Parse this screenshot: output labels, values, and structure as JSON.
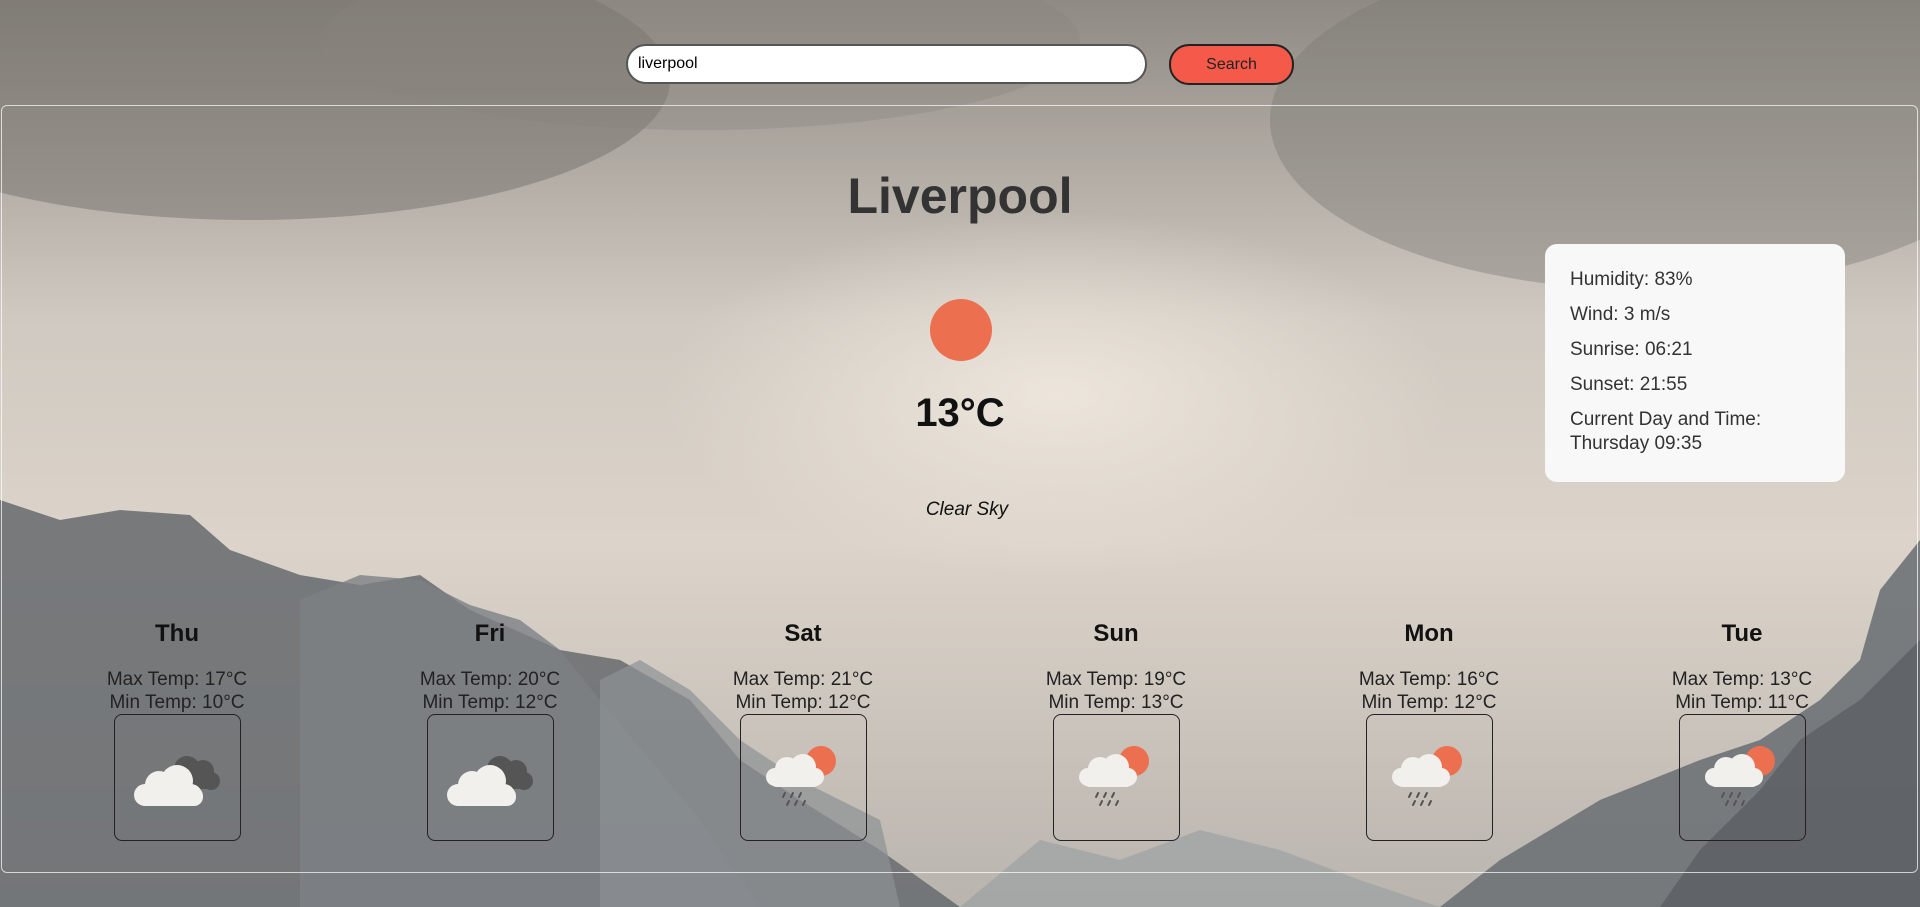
{
  "search": {
    "value": "liverpool",
    "button_label": "Search"
  },
  "current": {
    "city": "Liverpool",
    "temperature": "13°C",
    "description": "Clear Sky",
    "icon": "sun-icon",
    "details": {
      "humidity": "Humidity: 83%",
      "wind": "Wind: 3 m/s",
      "sunrise": "Sunrise: 06:21",
      "sunset": "Sunset: 21:55",
      "datetime_label": "Current Day and Time:",
      "datetime_value": "Thursday 09:35"
    }
  },
  "forecast": [
    {
      "day": "Thu",
      "max": "Max Temp: 17°C",
      "min": "Min Temp: 10°C",
      "icon": "broken-clouds-icon"
    },
    {
      "day": "Fri",
      "max": "Max Temp: 20°C",
      "min": "Min Temp: 12°C",
      "icon": "broken-clouds-icon"
    },
    {
      "day": "Sat",
      "max": "Max Temp: 21°C",
      "min": "Min Temp: 12°C",
      "icon": "sun-rain-cloud-icon"
    },
    {
      "day": "Sun",
      "max": "Max Temp: 19°C",
      "min": "Min Temp: 13°C",
      "icon": "sun-rain-cloud-icon"
    },
    {
      "day": "Mon",
      "max": "Max Temp: 16°C",
      "min": "Min Temp: 12°C",
      "icon": "sun-rain-cloud-icon"
    },
    {
      "day": "Tue",
      "max": "Max Temp: 13°C",
      "min": "Min Temp: 11°C",
      "icon": "sun-rain-cloud-icon"
    }
  ],
  "colors": {
    "accent": "#f4594a",
    "sun": "#ec6f4f"
  }
}
